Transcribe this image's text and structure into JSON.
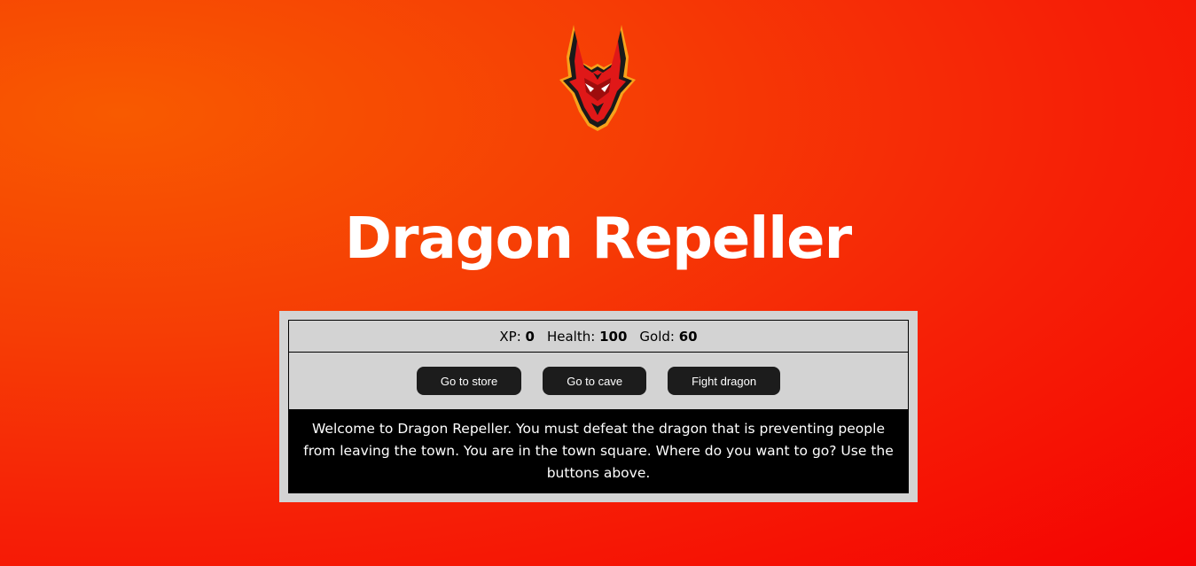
{
  "header": {
    "logo_icon": "dragon-head-icon",
    "title": "Dragon Repeller"
  },
  "stats": {
    "xp_label": "XP:",
    "xp_value": "0",
    "health_label": "Health:",
    "health_value": "100",
    "gold_label": "Gold:",
    "gold_value": "60"
  },
  "controls": {
    "button1": "Go to store",
    "button2": "Go to cave",
    "button3": "Fight dragon"
  },
  "text": "Welcome to Dragon Repeller. You must defeat the dragon that is preventing people from leaving the town. You are in the town square. Where do you want to go? Use the buttons above.",
  "colors": {
    "background_start": "#f85a00",
    "background_end": "#f50202",
    "panel": "#d3d3d3",
    "button": "#1c1c1c",
    "text_box": "#000000"
  }
}
